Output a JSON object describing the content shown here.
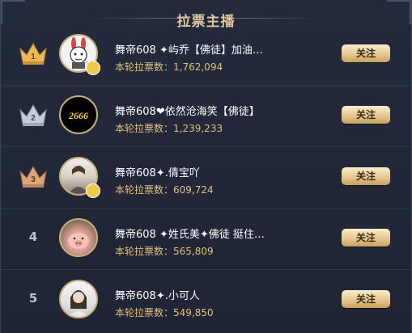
{
  "header": {
    "title": "拉票主播"
  },
  "labels": {
    "votes_prefix": "本轮拉票数："
  },
  "rows": [
    {
      "rank": "1",
      "name": "舞帝608 ✦屿乔【佛徒】加油…",
      "votes": "1,762,094",
      "follow": "关注",
      "crown": "gold"
    },
    {
      "rank": "2",
      "name": "舞帝608❤依然沧海笑【佛徒】",
      "votes": "1,239,233",
      "follow": "关注",
      "crown": "silver"
    },
    {
      "rank": "3",
      "name": "舞帝608✦.倩宝吖",
      "votes": "609,724",
      "follow": "关注",
      "crown": "bronze"
    },
    {
      "rank": "4",
      "name": "舞帝608 ✦姓氏美✦佛徒 挺住…",
      "votes": "565,809",
      "follow": "关注"
    },
    {
      "rank": "5",
      "name": "舞帝608✦.小可人",
      "votes": "549,850",
      "follow": "关注"
    }
  ],
  "avatar_text": {
    "row2": "2666"
  },
  "colors": {
    "gold": "#e8b85a",
    "silver": "#aeb9c8",
    "bronze": "#d49b6e",
    "accent": "#dfc79a"
  }
}
